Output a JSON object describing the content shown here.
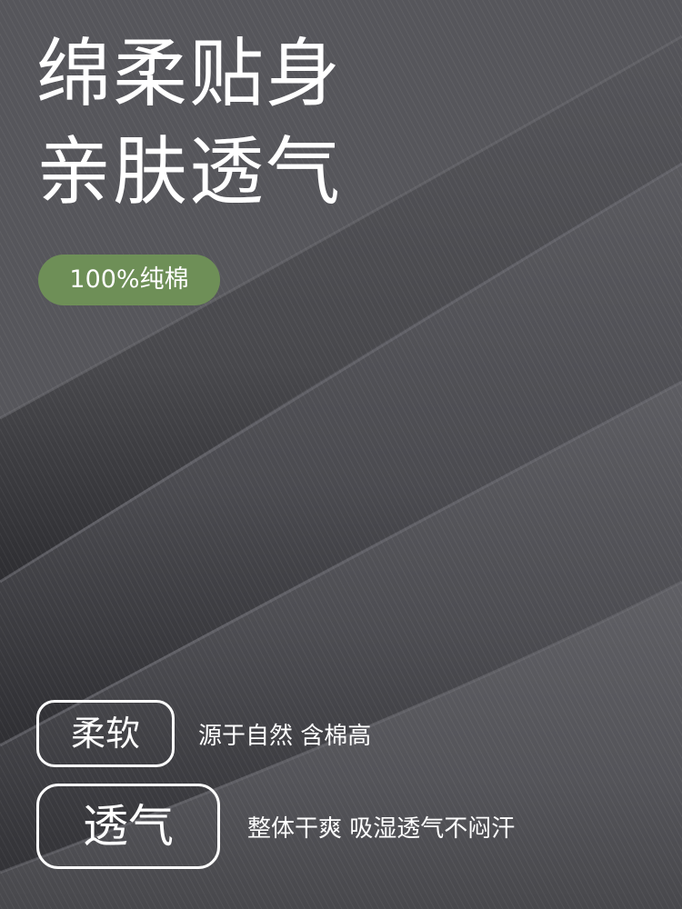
{
  "headline": {
    "line1": "绵柔贴身",
    "line2": "亲肤透气"
  },
  "badge": {
    "text": "100%纯棉",
    "color": "#6e8f57"
  },
  "features": [
    {
      "label": "柔软",
      "description": "源于自然 含棉高"
    },
    {
      "label": "透气",
      "description": "整体干爽 吸湿透气不闷汗"
    }
  ],
  "colors": {
    "fabric": "#4a4a4e",
    "text": "#ffffff"
  }
}
